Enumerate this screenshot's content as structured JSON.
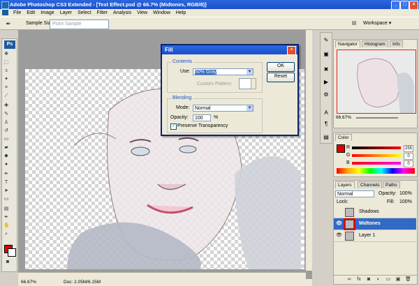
{
  "window": {
    "title": "Adobe Photoshop CS3 Extended - [Text Effect.psd @ 66.7% (Midtones, RGB/8)]"
  },
  "menu": [
    "File",
    "Edit",
    "Image",
    "Layer",
    "Select",
    "Filter",
    "Analysis",
    "View",
    "Window",
    "Help"
  ],
  "options": {
    "sample_size_label": "Sample Size:",
    "sample_size_value": "Point Sample",
    "workspace_label": "Workspace"
  },
  "status": {
    "zoom": "66.67%",
    "doc": "Doc: 2.05M/6.15M"
  },
  "dialog": {
    "title": "Fill",
    "contents_group": "Contents",
    "use_label": "Use:",
    "use_value": "50% Gray",
    "custom_pattern_label": "Custom Pattern:",
    "blending_group": "Blending",
    "mode_label": "Mode:",
    "mode_value": "Normal",
    "opacity_label": "Opacity:",
    "opacity_value": "100",
    "opacity_unit": "%",
    "preserve_label": "Preserve Transparency",
    "ok": "OK",
    "reset": "Reset"
  },
  "navigator": {
    "tabs": [
      "Navigator",
      "Histogram",
      "Info"
    ],
    "zoom": "66.67%"
  },
  "color": {
    "tab": "Color",
    "r_label": "R",
    "g_label": "G",
    "b_label": "B",
    "r_value": "255",
    "g_value": "0",
    "b_value": "0"
  },
  "layers": {
    "tabs": [
      "Layers",
      "Channels",
      "Paths"
    ],
    "blend_mode": "Normal",
    "opacity_label": "Opacity:",
    "opacity_value": "100%",
    "lock_label": "Lock:",
    "fill_label": "Fill:",
    "fill_value": "100%",
    "items": [
      {
        "name": "Shadows"
      },
      {
        "name": "Midtones"
      },
      {
        "name": "Layer 1"
      }
    ]
  },
  "colors": {
    "accent": "#316ac5",
    "foreground": "#e00000"
  }
}
